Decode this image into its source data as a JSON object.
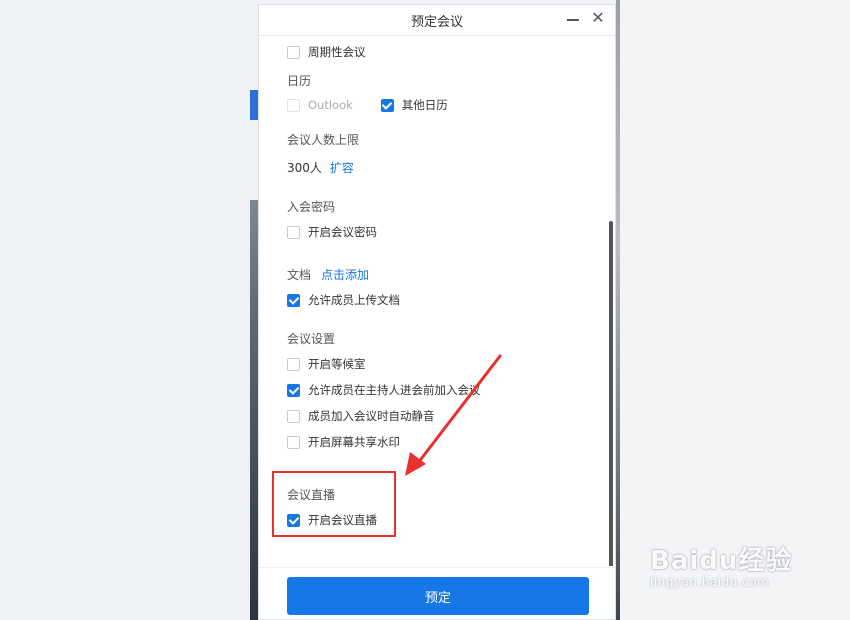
{
  "dialog": {
    "title": "预定会议",
    "close_glyph": "✕"
  },
  "recurring": {
    "label": "周期性会议",
    "checked": false
  },
  "calendar": {
    "section_title": "日历",
    "outlook_label": "Outlook",
    "other_label": "其他日历"
  },
  "capacity": {
    "section_title": "会议人数上限",
    "value": "300人",
    "expand_link": "扩容"
  },
  "password": {
    "section_title": "入会密码",
    "enable_label": "开启会议密码"
  },
  "docs": {
    "section_title": "文档",
    "add_link": "点击添加",
    "upload_label": "允许成员上传文档"
  },
  "settings": {
    "section_title": "会议设置",
    "waiting_room": "开启等候室",
    "join_before_host": "允许成员在主持人进会前加入会议",
    "auto_mute": "成员加入会议时自动静音",
    "watermark": "开启屏幕共享水印"
  },
  "live": {
    "section_title": "会议直播",
    "enable_label": "开启会议直播"
  },
  "footer": {
    "submit_label": "预定"
  },
  "watermark_text": {
    "main": "Baidu经验",
    "sub": "jingyan.baidu.com"
  },
  "colors": {
    "accent": "#1677e6",
    "annotation_red": "#e8312c"
  }
}
